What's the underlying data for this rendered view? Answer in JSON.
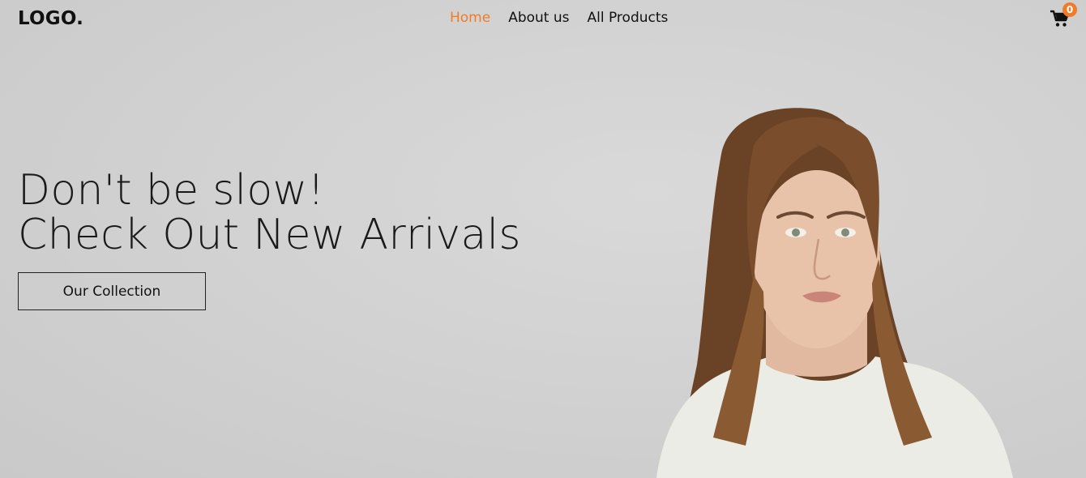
{
  "navbar": {
    "logo": "LOGO.",
    "links": [
      {
        "label": "Home",
        "active": true
      },
      {
        "label": "About us",
        "active": false
      },
      {
        "label": "All Products",
        "active": false
      }
    ],
    "cart": {
      "icon": "cart-icon",
      "count": "0"
    }
  },
  "hero": {
    "headline_line1": "Don't be slow!",
    "headline_line2": "Check Out New Arrivals",
    "cta_label": "Our Collection",
    "image": "model-photo"
  },
  "colors": {
    "accent": "#f07c2a",
    "background": "#d3d3d3",
    "text": "#111111"
  }
}
